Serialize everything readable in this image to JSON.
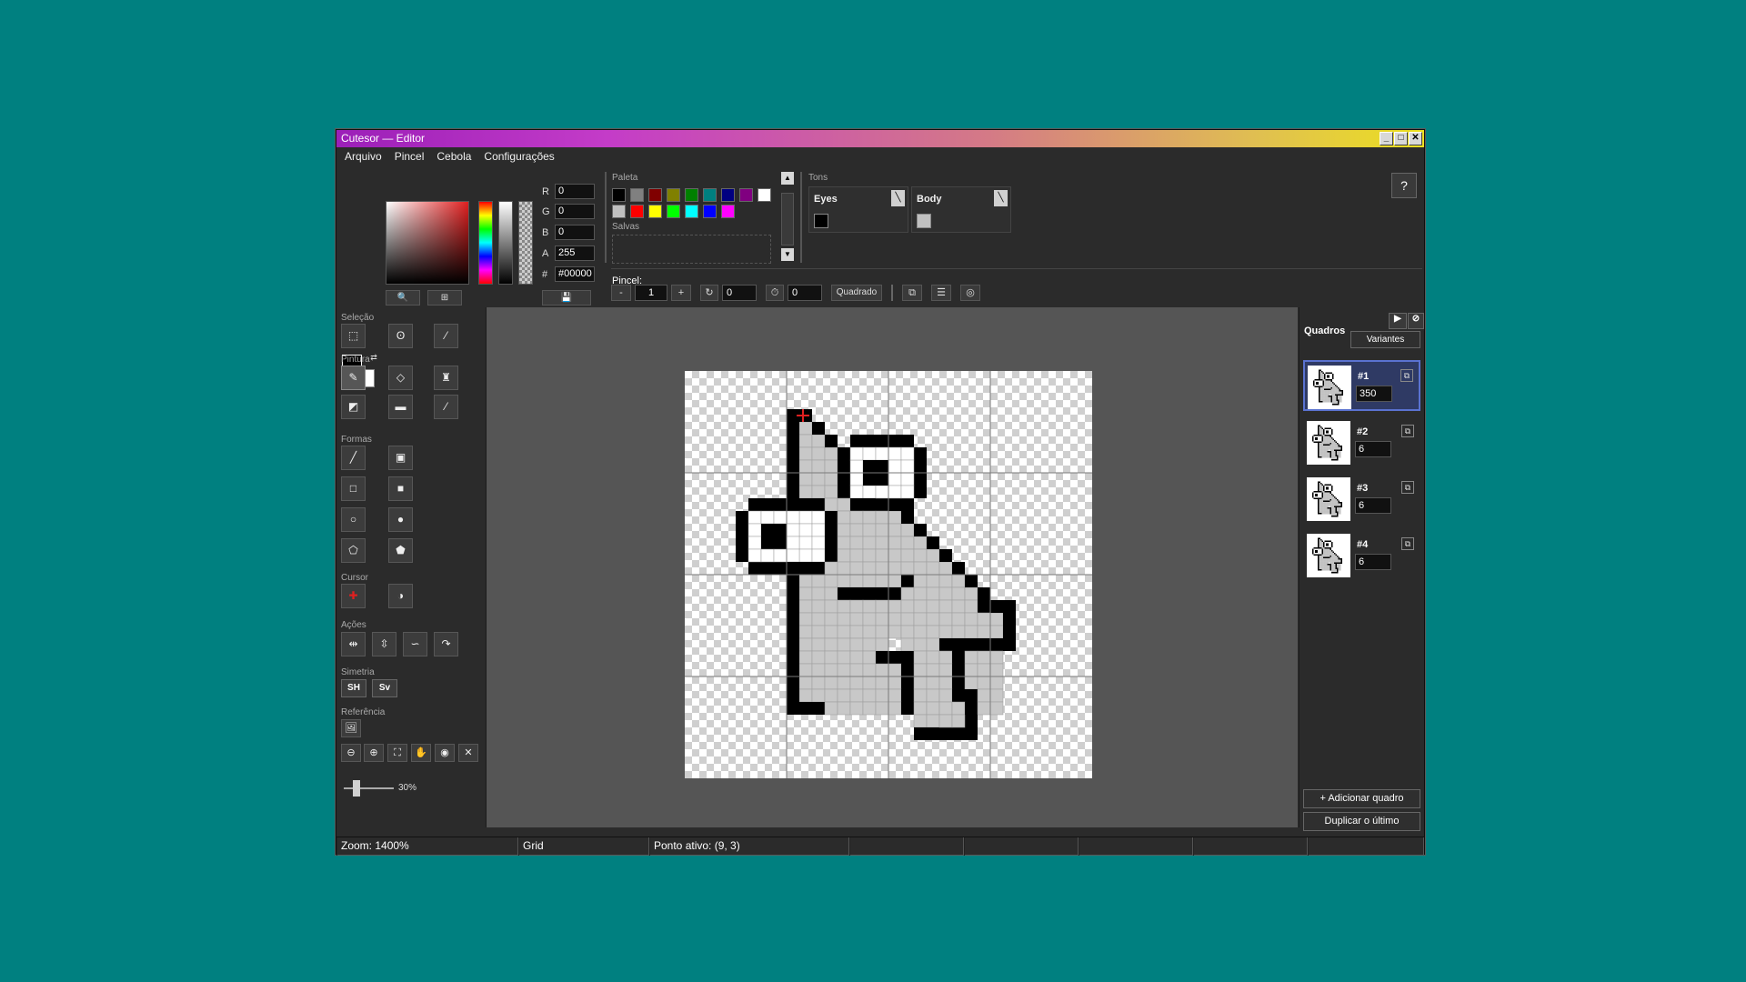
{
  "window": {
    "title": "Cutesor — Editor"
  },
  "menu": [
    "Arquivo",
    "Pincel",
    "Cebola",
    "Configurações"
  ],
  "color": {
    "fg": "#000000",
    "bg": "#ffffff",
    "r": "0",
    "g": "0",
    "b": "0",
    "a": "255",
    "hex": "#00000",
    "labels": {
      "r": "R",
      "g": "G",
      "b": "B",
      "a": "A",
      "hex": "#"
    }
  },
  "palette": {
    "label": "Paleta",
    "colors": [
      "#000000",
      "#808080",
      "#800000",
      "#808000",
      "#008000",
      "#008080",
      "#000080",
      "#800080",
      "#ffffff",
      "#c0c0c0",
      "#ff0000",
      "#ffff00",
      "#00ff00",
      "#00ffff",
      "#0000ff",
      "#ff00ff"
    ],
    "saved_label": "Salvas"
  },
  "tones": {
    "label": "Tons",
    "items": [
      {
        "name": "Eyes",
        "color": "#000000"
      },
      {
        "name": "Body",
        "color": "#c0c0c0"
      }
    ]
  },
  "help": "?",
  "brush": {
    "label": "Pincel:",
    "minus": "-",
    "size": "1",
    "plus": "+",
    "rotation": "0",
    "timer": "0",
    "shape": "Quadrado"
  },
  "tools": {
    "selection_label": "Seleção",
    "paint_label": "Pintura",
    "shapes_label": "Formas",
    "cursor_label": "Cursor",
    "actions_label": "Ações",
    "symmetry_label": "Simetria",
    "sym_h": "SH",
    "sym_v": "Sv",
    "reference_label": "Referência",
    "ref_opacity": "30%"
  },
  "frames": {
    "title": "Quadros",
    "variants": "Variantes",
    "items": [
      {
        "num": "#1",
        "duration": "350"
      },
      {
        "num": "#2",
        "duration": "6"
      },
      {
        "num": "#3",
        "duration": "6"
      },
      {
        "num": "#4",
        "duration": "6"
      }
    ],
    "add": "+ Adicionar quadro",
    "duplicate": "Duplicar o último"
  },
  "status": {
    "zoom": "Zoom: 1400%",
    "grid": "Grid",
    "hotspot": "Ponto ativo: (9, 3)"
  }
}
